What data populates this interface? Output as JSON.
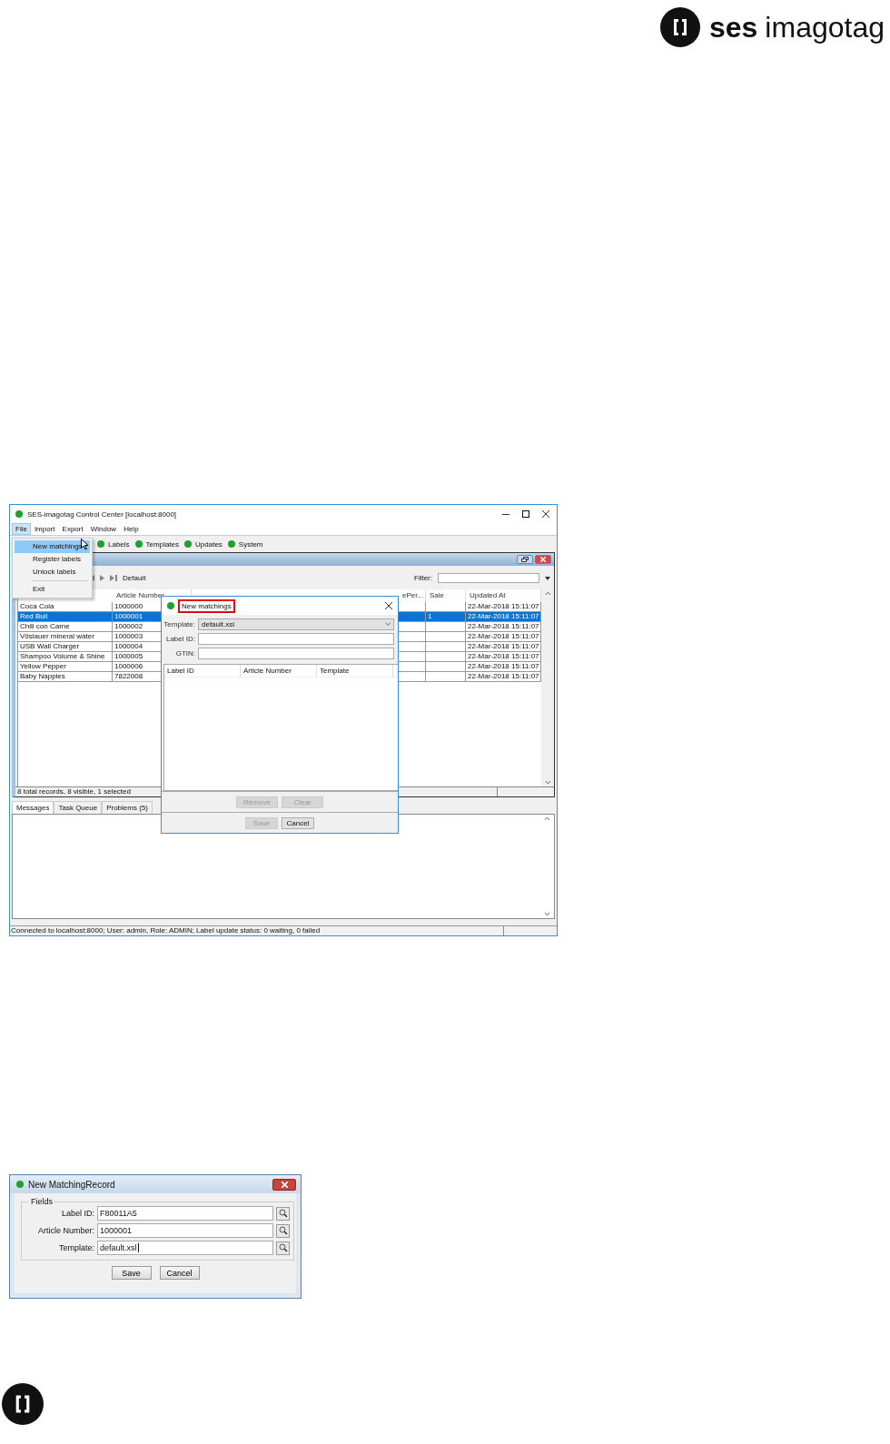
{
  "logo": {
    "bold": "ses",
    "light": "imagotag"
  },
  "window": {
    "title": "SES-imagotag Control Center [localhost:8000]",
    "menu": [
      {
        "label": "File",
        "selected": true
      },
      {
        "label": "Import",
        "selected": false
      },
      {
        "label": "Export",
        "selected": false
      },
      {
        "label": "Window",
        "selected": false
      },
      {
        "label": "Help",
        "selected": false
      }
    ],
    "file_menu": [
      {
        "label": "New matchings",
        "selected": true
      },
      {
        "label": "Register labels",
        "selected": false
      },
      {
        "label": "Unlock labels",
        "selected": false
      },
      {
        "label": "Exit",
        "selected": false
      }
    ],
    "status_items": [
      "Labels",
      "Templates",
      "Updates",
      "System"
    ],
    "nav": {
      "profile": "Default",
      "filter_label": "Filter:"
    },
    "table": {
      "columns": [
        "Article Number",
        "ePer...",
        "Sale",
        "Updated At"
      ],
      "rows": [
        {
          "name": "Coca Cola",
          "article_number": "1000000",
          "updated_at": "22-Mar-2018 15:11:07",
          "selected": false
        },
        {
          "name": "Red Bull",
          "article_number": "1000001",
          "sale": "1",
          "updated_at": "22-Mar-2018 15:11:07",
          "selected": true
        },
        {
          "name": "Chili con Carne",
          "article_number": "1000002",
          "updated_at": "22-Mar-2018 15:11:07",
          "selected": false
        },
        {
          "name": "Vöslauer mineral water",
          "article_number": "1000003",
          "updated_at": "22-Mar-2018 15:11:07",
          "selected": false
        },
        {
          "name": "USB Wall Charger",
          "article_number": "1000004",
          "updated_at": "22-Mar-2018 15:11:07",
          "selected": false
        },
        {
          "name": "Shampoo Volume & Shine",
          "article_number": "1000005",
          "updated_at": "22-Mar-2018 15:11:07",
          "selected": false
        },
        {
          "name": "Yellow Pepper",
          "article_number": "1000006",
          "updated_at": "22-Mar-2018 15:11:07",
          "selected": false
        },
        {
          "name": "Baby Nappies",
          "article_number": "7822008",
          "updated_at": "22-Mar-2018 15:11:07",
          "selected": false
        }
      ],
      "summary": "8 total records, 8 visible, 1 selected"
    },
    "bottom_tabs": [
      {
        "label": "Messages",
        "selected": true
      },
      {
        "label": "Task Queue",
        "selected": false
      },
      {
        "label": "Problems (5)",
        "selected": false
      }
    ],
    "status_bar": "Connected to localhost:8000; User: admin, Role: ADMIN; Label update status: 0 waiting, 0 failed"
  },
  "matchings_dialog": {
    "title": "New matchings",
    "template_label": "Template:",
    "template_value": "default.xsl",
    "label_id_label": "Label ID:",
    "gtin_label": "GTIN:",
    "columns": [
      "Label ID",
      "Article Number",
      "Template"
    ],
    "table_buttons": [
      {
        "label": "Remove",
        "disabled": true
      },
      {
        "label": "Clear",
        "disabled": true
      }
    ],
    "buttons": [
      {
        "label": "Save",
        "disabled": true
      },
      {
        "label": "Cancel",
        "disabled": false
      }
    ]
  },
  "record_dialog": {
    "title": "New MatchingRecord",
    "group": "Fields",
    "fields": [
      {
        "label": "Label ID:",
        "value": "F80011A5"
      },
      {
        "label": "Article Number:",
        "value": "1000001"
      },
      {
        "label": "Template:",
        "value": "default.xsl"
      }
    ],
    "buttons": [
      "Save",
      "Cancel"
    ]
  }
}
